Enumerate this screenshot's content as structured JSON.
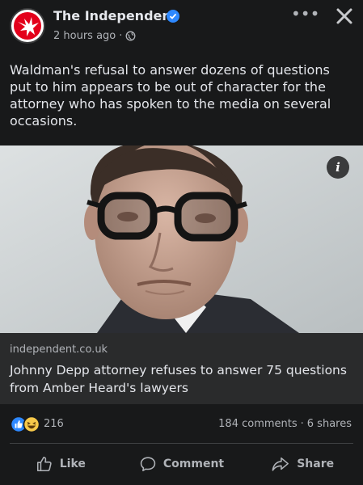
{
  "post": {
    "page_name": "The Independent",
    "time": "2 hours ago",
    "separator": "·",
    "text": "Waldman's refusal to answer dozens of questions put to him appears to be out of character for the attorney who has spoken to the media on several occasions."
  },
  "link": {
    "domain": "independent.co.uk",
    "headline": "Johnny Depp attorney refuses to answer 75 questions from Amber Heard's lawyers"
  },
  "stats": {
    "reactions_count": "216",
    "comments": "184 comments",
    "dot": "·",
    "shares": "6 shares"
  },
  "actions": {
    "like": "Like",
    "comment": "Comment",
    "share": "Share"
  },
  "icons": {
    "more": "more-options-icon",
    "close": "close-icon",
    "privacy": "globe-icon",
    "info": "i"
  },
  "colors": {
    "background": "#18191a",
    "link_card": "#2a2b2c",
    "brand_red": "#e3001b",
    "verified_blue": "#2d88ff",
    "muted_text": "#b0b3b8"
  }
}
